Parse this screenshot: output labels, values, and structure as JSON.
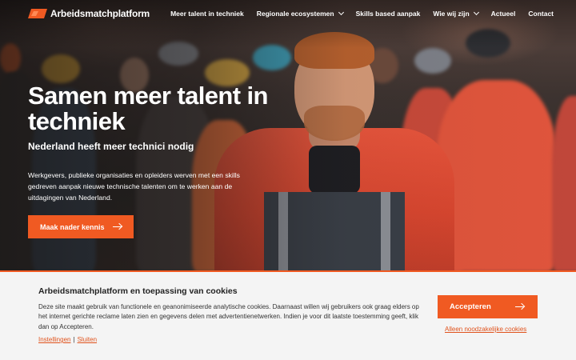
{
  "brand": {
    "name": "Arbeidsmatchplatform",
    "accent": "#f05a22"
  },
  "nav": {
    "items": [
      {
        "label": "Meer talent in techniek",
        "has_dropdown": false
      },
      {
        "label": "Regionale ecosystemen",
        "has_dropdown": true
      },
      {
        "label": "Skills based aanpak",
        "has_dropdown": false
      },
      {
        "label": "Wie wij zijn",
        "has_dropdown": true
      },
      {
        "label": "Actueel",
        "has_dropdown": false
      },
      {
        "label": "Contact",
        "has_dropdown": false
      }
    ]
  },
  "hero": {
    "title": "Samen meer talent in techniek",
    "subtitle": "Nederland heeft meer technici nodig",
    "text": "Werkgevers, publieke organisaties en opleiders werven met een skills gedreven aanpak nieuwe technische talenten om te werken aan de uitdagingen van Nederland.",
    "cta_label": "Maak nader kennis",
    "cta_icon": "arrow-right-icon"
  },
  "cookie": {
    "title": "Arbeidsmatchplatform en toepassing van cookies",
    "text": "Deze site maakt gebruik van functionele en geanonimiseerde analytische cookies. Daarnaast willen wij gebruikers ook graag elders op het internet gerichte reclame laten zien en gegevens delen met advertentienetwerken. Indien je voor dit laatste toestemming geeft, klik dan op Accepteren.",
    "settings_label": "Instellingen",
    "separator": "|",
    "close_label": "Sluiten",
    "accept_label": "Accepteren",
    "necessary_label": "Alleen noodzakelijke cookies"
  }
}
